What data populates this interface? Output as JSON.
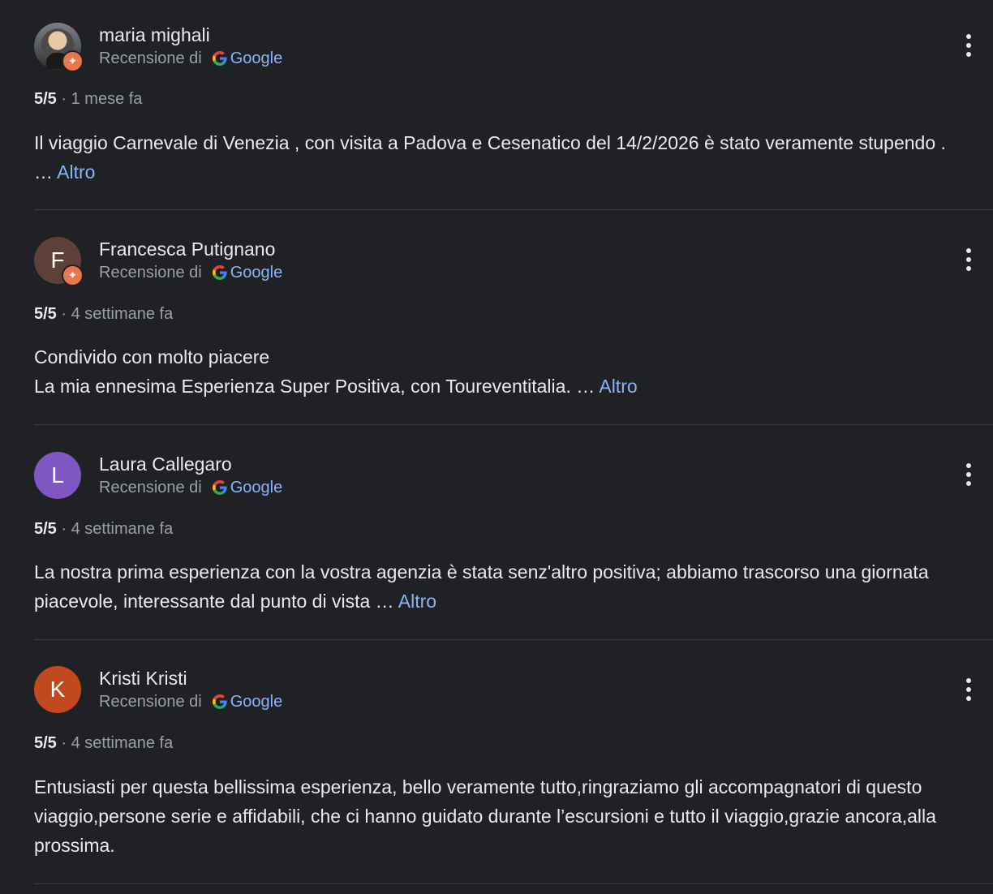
{
  "reviews": [
    {
      "name": "maria mighali",
      "avatar": {
        "type": "photo",
        "local_guide": true
      },
      "source_prefix": "Recensione di",
      "source_name": "Google",
      "rating": "5/5",
      "separator": "·",
      "time": "1 mese fa",
      "text": "Il viaggio Carnevale di Venezia , con visita a Padova e Cesenatico del 14/2/2026 è stato veramente stupendo . …",
      "more_label": "Altro"
    },
    {
      "name": "Francesca Putignano",
      "avatar": {
        "type": "letter",
        "letter": "F",
        "color": "#5d4037",
        "local_guide": true
      },
      "source_prefix": "Recensione di",
      "source_name": "Google",
      "rating": "5/5",
      "separator": "·",
      "time": "4 settimane fa",
      "text_lines": [
        "Condivido con molto piacere",
        "La mia ennesima Esperienza Super Positiva, con Toureventitalia. …"
      ],
      "more_label": "Altro"
    },
    {
      "name": "Laura Callegaro",
      "avatar": {
        "type": "letter",
        "letter": "L",
        "color": "#7e57c2",
        "local_guide": false
      },
      "source_prefix": "Recensione di",
      "source_name": "Google",
      "rating": "5/5",
      "separator": "·",
      "time": "4 settimane fa",
      "text": "La nostra prima esperienza con la vostra agenzia è stata senz'altro positiva; abbiamo trascorso una giornata piacevole, interessante dal punto di vista …",
      "more_label": "Altro"
    },
    {
      "name": "Kristi Kristi",
      "avatar": {
        "type": "letter",
        "letter": "K",
        "color": "#c2491d",
        "local_guide": false
      },
      "source_prefix": "Recensione di",
      "source_name": "Google",
      "rating": "5/5",
      "separator": "·",
      "time": "4 settimane fa",
      "text": "Entusiasti per questa bellissima esperienza, bello veramente tutto,ringraziamo gli accompagnatori di questo viaggio,persone serie e affidabili, che ci hanno guidato durante l’escursioni e tutto il viaggio,grazie ancora,alla prossima."
    }
  ],
  "icons": {
    "google": "google-g-icon",
    "more": "more-vert-icon",
    "local_guide": "local-guide-badge-icon"
  },
  "colors": {
    "background": "#202124",
    "text": "#e8eaed",
    "muted": "#9aa0a6",
    "link": "#8ab4f8",
    "divider": "#3c4043"
  }
}
